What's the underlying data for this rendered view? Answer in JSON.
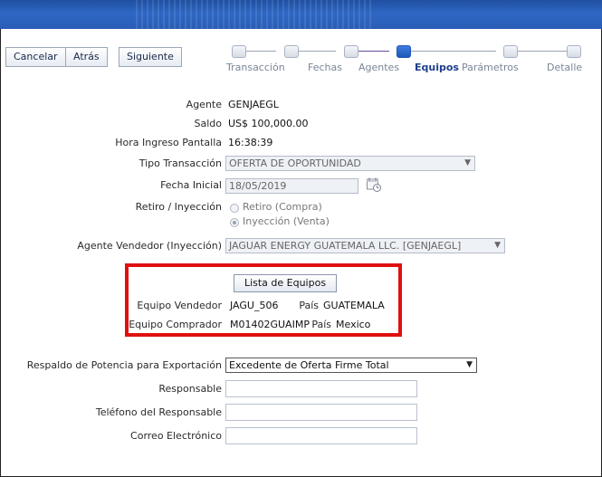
{
  "toolbar": {
    "cancel": "Cancelar",
    "back": "Atrás",
    "next": "Siguiente"
  },
  "wizard": {
    "steps": [
      {
        "label": "Transacción"
      },
      {
        "label": "Fechas"
      },
      {
        "label": "Agentes"
      },
      {
        "label": "Equipos"
      },
      {
        "label": "Parámetros"
      },
      {
        "label": "Detalle"
      }
    ],
    "active_step": "Equipos"
  },
  "form": {
    "agente": {
      "label": "Agente",
      "value": "GENJAEGL"
    },
    "saldo": {
      "label": "Saldo",
      "value": "US$ 100,000.00"
    },
    "hora": {
      "label": "Hora Ingreso Pantalla",
      "value": "16:38:39"
    },
    "tipo": {
      "label": "Tipo Transacción",
      "value": "OFERTA DE OPORTUNIDAD"
    },
    "fecha": {
      "label": "Fecha Inicial",
      "value": "18/05/2019"
    },
    "retiro": {
      "label": "Retiro / Inyección",
      "option1": "Retiro (Compra)",
      "option2": "Inyección (Venta)",
      "selected": "Inyección (Venta)"
    },
    "vendedor": {
      "label": "Agente Vendedor (Inyección)",
      "value": "JAGUAR ENERGY GUATEMALA LLC. [GENJAEGL]"
    },
    "equipos": {
      "button": "Lista de Equipos",
      "vendedor_label": "Equipo Vendedor",
      "vendedor_value": "JAGU_506",
      "vendedor_pais_label": "País",
      "vendedor_pais": "GUATEMALA",
      "comprador_label": "Equipo Comprador",
      "comprador_value": "M01402GUAIMP",
      "comprador_pais_label": "País",
      "comprador_pais": "Mexico"
    },
    "respaldo": {
      "label": "Respaldo de Potencia para Exportación",
      "value": "Excedente de Oferta Firme Total"
    },
    "responsable": {
      "label": "Responsable",
      "value": ""
    },
    "telefono": {
      "label": "Teléfono del Responsable",
      "value": ""
    },
    "correo": {
      "label": "Correo Electrónico",
      "value": ""
    }
  },
  "colors": {
    "header": "#2a5db6",
    "highlight": "#e01010",
    "active_step": "#1c3f8c"
  },
  "icons": {
    "dropdown": "chevron-down-icon",
    "calendar": "calendar-icon"
  }
}
